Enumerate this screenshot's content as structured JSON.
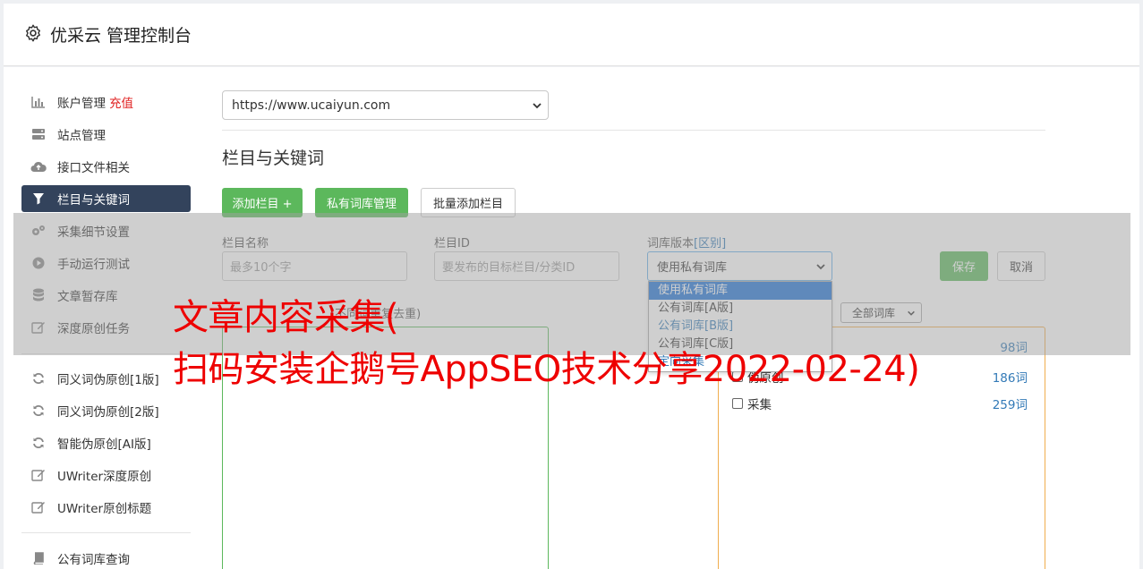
{
  "app": {
    "title": "优采云 管理控制台",
    "icon": "gear-icon"
  },
  "sidebar": {
    "items": [
      {
        "label": "账户管理",
        "badge": "充值",
        "icon": "bar-chart-icon"
      },
      {
        "label": "站点管理",
        "icon": "server-icon"
      },
      {
        "label": "接口文件相关",
        "icon": "cloud-upload-icon"
      },
      {
        "label": "栏目与关键词",
        "icon": "filter-icon",
        "active": true
      },
      {
        "label": "采集细节设置",
        "icon": "cogs-icon"
      },
      {
        "label": "手动运行测试",
        "icon": "play-circle-icon"
      },
      {
        "label": "文章暂存库",
        "icon": "database-icon"
      },
      {
        "label": "深度原创任务",
        "icon": "edit-icon"
      },
      {
        "label": "同义词伪原创[1版]",
        "icon": "refresh-icon"
      },
      {
        "label": "同义词伪原创[2版]",
        "icon": "refresh-icon"
      },
      {
        "label": "智能伪原创[AI版]",
        "icon": "refresh-icon"
      },
      {
        "label": "UWriter深度原创",
        "icon": "edit-icon"
      },
      {
        "label": "UWriter原创标题",
        "icon": "edit-icon"
      },
      {
        "label": "公有词库查询",
        "icon": "book-icon"
      }
    ]
  },
  "main": {
    "site_select": {
      "value": "https://www.ucaiyun.com"
    },
    "section_title": "栏目与关键词",
    "buttons": {
      "add_column": "添加栏目 +",
      "private_lib": "私有词库管理",
      "batch_add": "批量添加栏目"
    },
    "form": {
      "name_label": "栏目名称",
      "name_placeholder": "最多10个字",
      "id_label": "栏目ID",
      "id_placeholder": "要发布的目标栏目/分类ID",
      "lib_label": "词库版本",
      "lib_label_link": "[区别]",
      "lib_value": "使用私有词库",
      "save": "保存",
      "cancel": "取消"
    },
    "lib_options": [
      "使用私有词库",
      "公有词库[A版]",
      "公有词库[B版]",
      "公有词库[C版]",
      "定向采集"
    ],
    "keyword_hint": "(不同词重复去重)",
    "filter_select": "全部词库",
    "lib_list": [
      {
        "name": "",
        "count": "98词"
      },
      {
        "name": "伪原创",
        "count": "186词"
      },
      {
        "name": "采集",
        "count": "259词"
      }
    ]
  },
  "watermark": {
    "line1": "文章内容采集(",
    "line2": "扫码安装企鹅号AppSEO技术分享2022-02-24)"
  },
  "colors": {
    "sidebar_active": "#33435c",
    "green_button": "#5cb85c",
    "recharge_red": "#e02020",
    "watermark_red": "#ee0000",
    "link_blue": "#337ab7"
  }
}
